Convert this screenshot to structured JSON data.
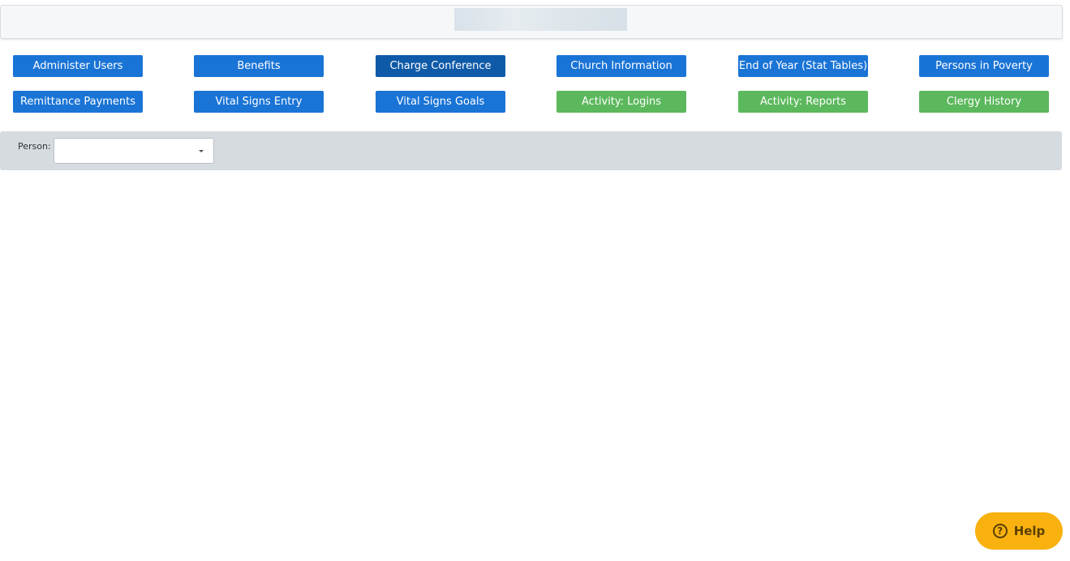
{
  "buttons": {
    "administer_users": "Administer Users",
    "benefits": "Benefits",
    "charge_conference": "Charge Conference",
    "church_information": "Church Information",
    "end_of_year": "End of Year (Stat Tables)",
    "persons_in_poverty": "Persons in Poverty",
    "remittance_payments": "Remittance Payments",
    "vital_signs_entry": "Vital Signs Entry",
    "vital_signs_goals": "Vital Signs Goals",
    "activity_logins": "Activity: Logins",
    "activity_reports": "Activity: Reports",
    "clergy_history": "Clergy History"
  },
  "filter": {
    "person_label": "Person:",
    "person_value": ""
  },
  "help": {
    "label": "Help",
    "icon": "question-circle-icon"
  },
  "colors": {
    "blue": "#1a74d6",
    "active_blue": "#0f5aa8",
    "green": "#5cb85c",
    "help": "#f9b10f"
  }
}
